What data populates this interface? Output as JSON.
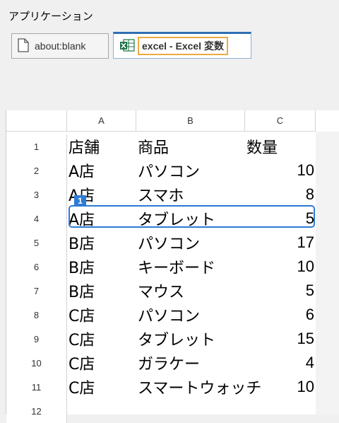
{
  "app": {
    "title": "アプリケーション"
  },
  "tabs": [
    {
      "label": "about:blank",
      "icon": "page-icon"
    },
    {
      "label": "excel - Excel 変数",
      "icon": "excel-icon"
    }
  ],
  "sheet": {
    "columns": [
      "A",
      "B",
      "C"
    ],
    "rows": [
      {
        "n": "1",
        "a": "店舗",
        "b": "商品",
        "c": "数量"
      },
      {
        "n": "2",
        "a": "A店",
        "b": "パソコン",
        "c": "10"
      },
      {
        "n": "3",
        "a": "A店",
        "b": "スマホ",
        "c": "8"
      },
      {
        "n": "4",
        "a": "A店",
        "b": "タブレット",
        "c": "5"
      },
      {
        "n": "5",
        "a": "B店",
        "b": "パソコン",
        "c": "17"
      },
      {
        "n": "6",
        "a": "B店",
        "b": "キーボード",
        "c": "10"
      },
      {
        "n": "7",
        "a": "B店",
        "b": "マウス",
        "c": "5"
      },
      {
        "n": "8",
        "a": "C店",
        "b": "パソコン",
        "c": "6"
      },
      {
        "n": "9",
        "a": "C店",
        "b": "タブレット",
        "c": "15"
      },
      {
        "n": "10",
        "a": "C店",
        "b": "ガラケー",
        "c": "4"
      },
      {
        "n": "11",
        "a": "C店",
        "b": "スマートウォッチ",
        "c": "10"
      },
      {
        "n": "12",
        "a": "",
        "b": "",
        "c": ""
      }
    ],
    "selection_badge": "1"
  }
}
